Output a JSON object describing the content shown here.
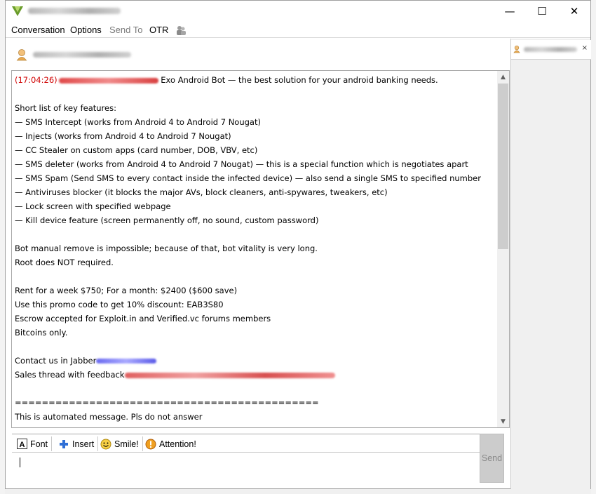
{
  "window": {
    "minimize_glyph": "—",
    "maximize_glyph": "☐",
    "close_glyph": "✕"
  },
  "menu": {
    "conversation": "Conversation",
    "options": "Options",
    "send_to": "Send To",
    "otr": "OTR"
  },
  "chat": {
    "timestamp": "(17:04:26)",
    "first_line_text": "Exo Android Bot — the best solution for your android banking needs.",
    "lines": [
      "",
      "Short list of key features:",
      "— SMS Intercept (works from Android 4 to Android 7 Nougat)",
      "— Injects (works from Android 4 to Android 7 Nougat)",
      "— CC Stealer on custom apps (card number, DOB, VBV, etc)",
      "— SMS deleter (works from Android 4 to Android 7 Nougat) — this is a special function which is negotiates apart",
      "— SMS Spam (Send SMS to every contact inside the infected device) — also send a single SMS to specified number",
      "— Antiviruses blocker (it blocks the major AVs, block cleaners, anti-spywares, tweakers, etc)",
      "— Lock screen with specified webpage",
      "— Kill device feature (screen permanently off, no sound, custom password)",
      "",
      "Bot manual remove is impossible; because of that, bot vitality is very long.",
      "Root does NOT required.",
      "",
      "Rent for a week $750; For a month: $2400 ($600 save)",
      "Use this promo code to get 10% discount: EAB3S80",
      "Escrow accepted for Exploit.in and Verified.vc forums members",
      "Bitcoins only.",
      ""
    ],
    "contact_label": "Contact us in Jabber",
    "sales_label": "Sales thread with feedback",
    "separator": "=============================================",
    "footer": "This is automated message. Pls do not answer"
  },
  "toolbar": {
    "font": "Font",
    "insert": "Insert",
    "smile": "Smile!",
    "attention": "Attention!"
  },
  "send": {
    "label": "Send"
  },
  "side_tab": {
    "close_glyph": "×"
  },
  "icons": {
    "app": "pidgin-icon",
    "otr": "privacy-icon",
    "avatar": "buddy-icon",
    "font": "font-icon",
    "insert": "plus-icon",
    "smile": "smiley-icon",
    "attention": "attention-icon"
  },
  "colors": {
    "timestamp": "#d00000",
    "send_button_bg": "#cccccc"
  }
}
